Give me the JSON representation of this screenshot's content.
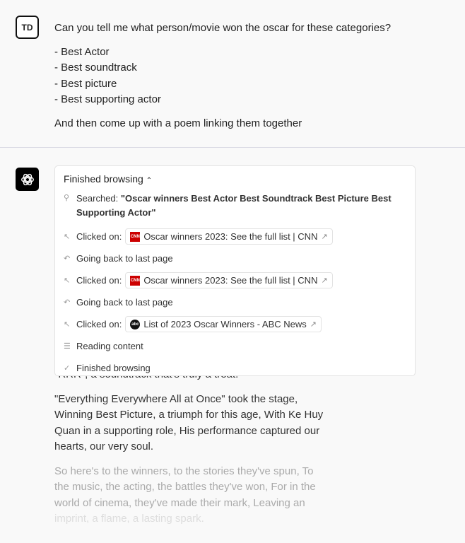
{
  "user": {
    "avatar": "TD",
    "question": "Can you tell me what person/movie won the oscar for these categories?",
    "categories": [
      "- Best Actor",
      "- Best soundtrack",
      "- Best picture",
      "- Best supporting actor"
    ],
    "followup": "And then come up with a poem linking them together"
  },
  "browsing": {
    "header": "Finished browsing",
    "search_label": "Searched:",
    "search_query": "\"Oscar winners Best Actor Best Soundtrack Best Picture Best Supporting Actor\"",
    "steps": [
      {
        "type": "click",
        "label": "Clicked on:",
        "link": "Oscar winners 2023: See the full list | CNN",
        "favicon": "CNN"
      },
      {
        "type": "back",
        "label": "Going back to last page"
      },
      {
        "type": "click",
        "label": "Clicked on:",
        "link": "Oscar winners 2023: See the full list | CNN",
        "favicon": "CNN"
      },
      {
        "type": "back",
        "label": "Going back to last page"
      },
      {
        "type": "click",
        "label": "Clicked on:",
        "link": "List of 2023 Oscar Winners - ABC News",
        "favicon": "abc"
      }
    ],
    "reading": "Reading content",
    "finished": "Finished browsing"
  },
  "poem": {
    "hidden_line": "\"RRR\", a soundtrack that's truly a treat.",
    "stanza1": "\"Everything Everywhere All at Once\" took the stage, Winning Best Picture, a triumph for this age, With Ke Huy Quan in a supporting role, His performance captured our hearts, our very soul.",
    "stanza2a": "So here's to the winners, to the stories they've spun, To the music, the acting, the battles they've won, For in the world of cinema, they've made their mark, Leaving an",
    "stanza2b": "imprint, a flame, a lasting spark."
  },
  "colors": {
    "cnn": "#cc0000",
    "abc": "#111111"
  }
}
